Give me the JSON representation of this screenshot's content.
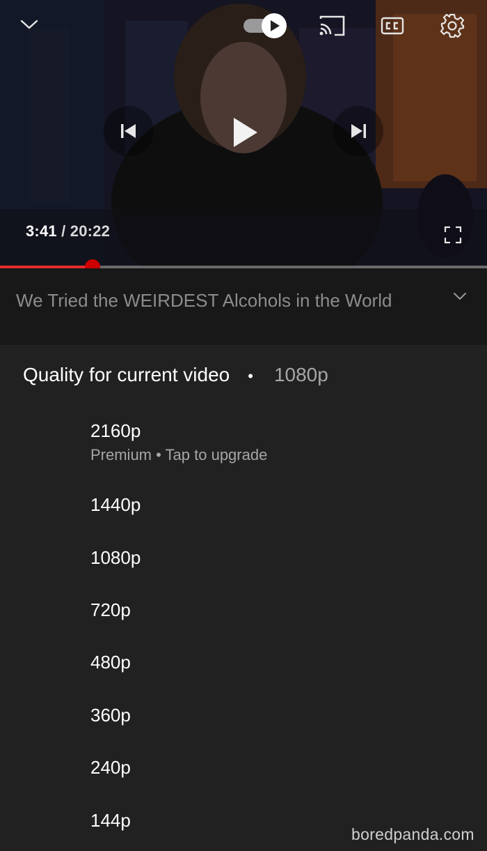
{
  "player": {
    "time_current": "3:41",
    "time_separator": "/",
    "time_total": "20:22",
    "progress_fraction": 0.19,
    "accent_color": "#cc0000"
  },
  "icons": {
    "collapse": "chevron-down-icon",
    "autoplay": "autoplay-toggle-icon",
    "cast": "cast-icon",
    "captions": "closed-captions-icon",
    "settings": "gear-icon",
    "previous": "skip-previous-icon",
    "play": "play-icon",
    "next": "skip-next-icon",
    "fullscreen": "fullscreen-icon",
    "expand": "chevron-down-icon"
  },
  "video": {
    "title": "We Tried the WEIRDEST Alcohols in the World"
  },
  "quality_sheet": {
    "header_label": "Quality for current video",
    "header_dot": "•",
    "current_quality": "1080p",
    "options": [
      {
        "label": "2160p",
        "sublabel": "Premium • Tap to upgrade"
      },
      {
        "label": "1440p"
      },
      {
        "label": "1080p"
      },
      {
        "label": "720p"
      },
      {
        "label": "480p"
      },
      {
        "label": "360p"
      },
      {
        "label": "240p"
      },
      {
        "label": "144p"
      }
    ]
  },
  "watermark": "boredpanda.com"
}
